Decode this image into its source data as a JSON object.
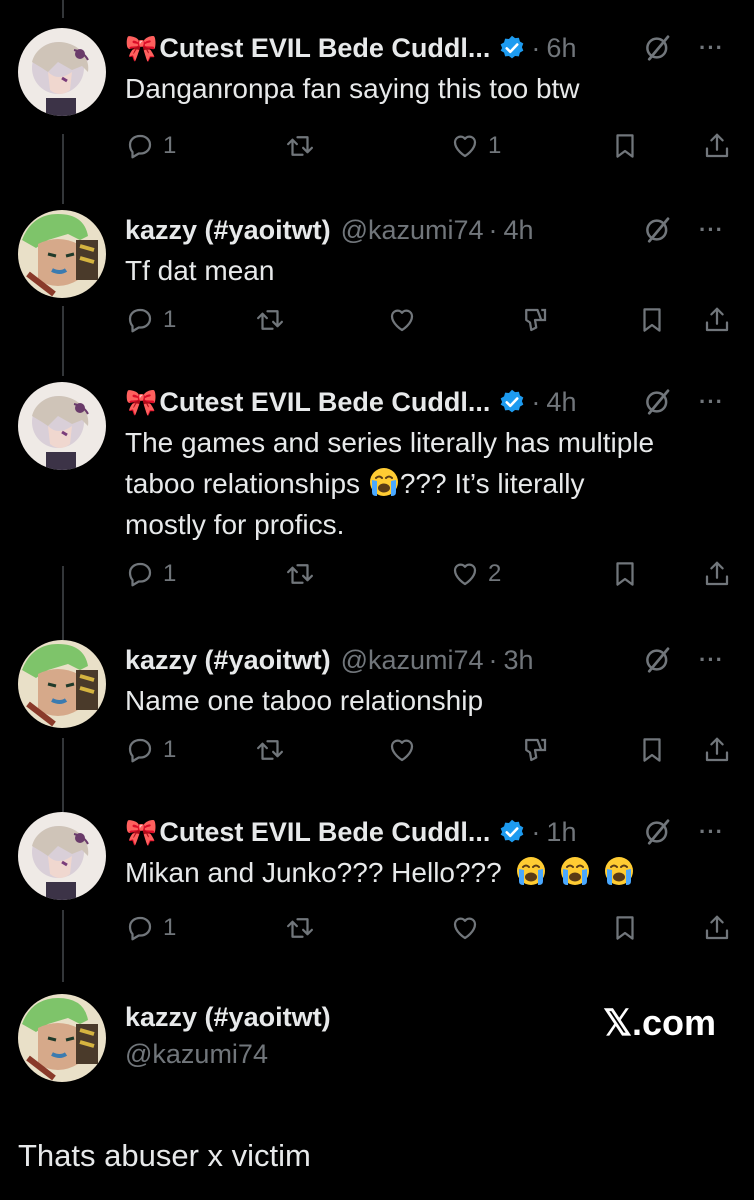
{
  "tweets": [
    {
      "bow": "🎀",
      "name": "Cutest EVIL Bede Cuddl...",
      "handle": "",
      "time": "6h",
      "verified": true,
      "text": "Danganronpa fan saying this too btw",
      "replies": "1",
      "likes": "1",
      "avatar": "bede"
    },
    {
      "bow": "",
      "name": "kazzy (#yaoitwt)",
      "handle": "@kazumi74",
      "time": "4h",
      "verified": false,
      "text": "Tf dat mean",
      "replies": "1",
      "likes": "",
      "avatar": "kazzy"
    },
    {
      "bow": "🎀",
      "name": "Cutest EVIL Bede Cuddl...",
      "handle": "",
      "time": "4h",
      "verified": true,
      "text_line1": "The games and series literally has multiple",
      "text_line2a": "taboo relationships",
      "text_line2b": "??? It’s literally",
      "text_line3": "mostly for profics.",
      "replies": "1",
      "likes": "2",
      "avatar": "bede"
    },
    {
      "bow": "",
      "name": "kazzy (#yaoitwt)",
      "handle": "@kazumi74",
      "time": "3h",
      "verified": false,
      "text": "Name one taboo relationship",
      "replies": "1",
      "likes": "",
      "avatar": "kazzy"
    },
    {
      "bow": "🎀",
      "name": "Cutest EVIL Bede Cuddl...",
      "handle": "",
      "time": "1h",
      "verified": true,
      "text": "Mikan and Junko??? Hello???",
      "replies": "1",
      "likes": "",
      "avatar": "bede"
    }
  ],
  "final": {
    "name": "kazzy (#yaoitwt)",
    "handle": "@kazumi74",
    "text": "Thats abuser x victim",
    "xcom": "𝕏.com"
  },
  "dot": "·",
  "more": "···",
  "colors": {
    "bg": "#000000",
    "text": "#e7e9ea",
    "muted": "#71767b",
    "verified": "#1d9bf0",
    "line": "#333639"
  },
  "icons": [
    "reply-icon",
    "retweet-icon",
    "like-icon",
    "bookmark-icon",
    "share-icon",
    "grok-icon",
    "more-icon",
    "verified-icon",
    "loudly-crying-face-icon"
  ]
}
